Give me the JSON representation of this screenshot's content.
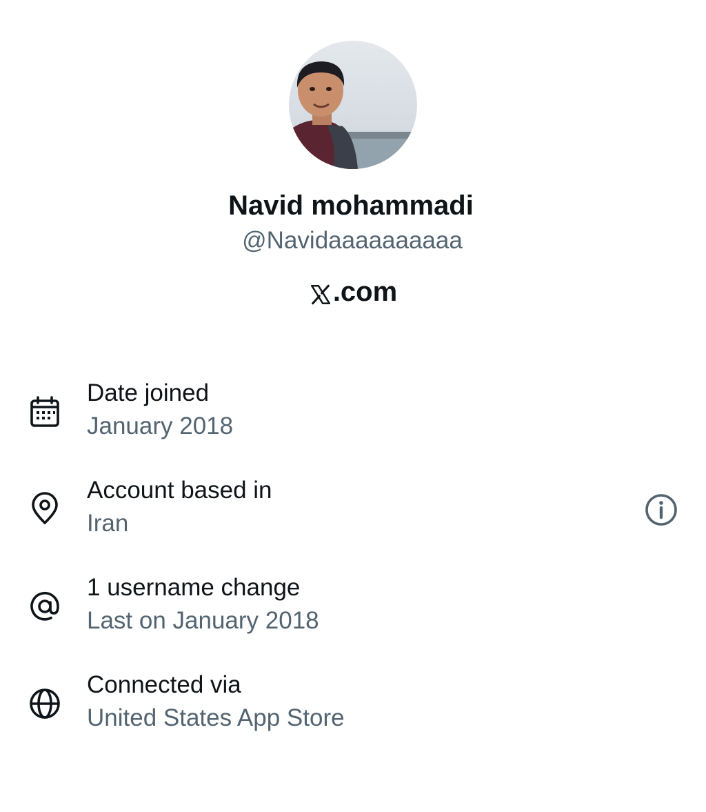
{
  "profile": {
    "display_name": "Navid mohammadi",
    "handle": "@Navidaaaaaaaaaa",
    "brand": ".com"
  },
  "about": {
    "rows": [
      {
        "icon": "calendar-icon",
        "title": "Date joined",
        "value": "January 2018"
      },
      {
        "icon": "location-pin-icon",
        "title": "Account based in",
        "value": "Iran"
      },
      {
        "icon": "at-sign-icon",
        "title": "1 username change",
        "value": "Last on January 2018"
      },
      {
        "icon": "globe-icon",
        "title": "Connected via",
        "value": "United States App Store"
      }
    ]
  },
  "icons": {
    "info_button": "info-icon"
  },
  "colors": {
    "primary_text": "#0f1419",
    "secondary_text": "#536471",
    "background": "#ffffff"
  }
}
